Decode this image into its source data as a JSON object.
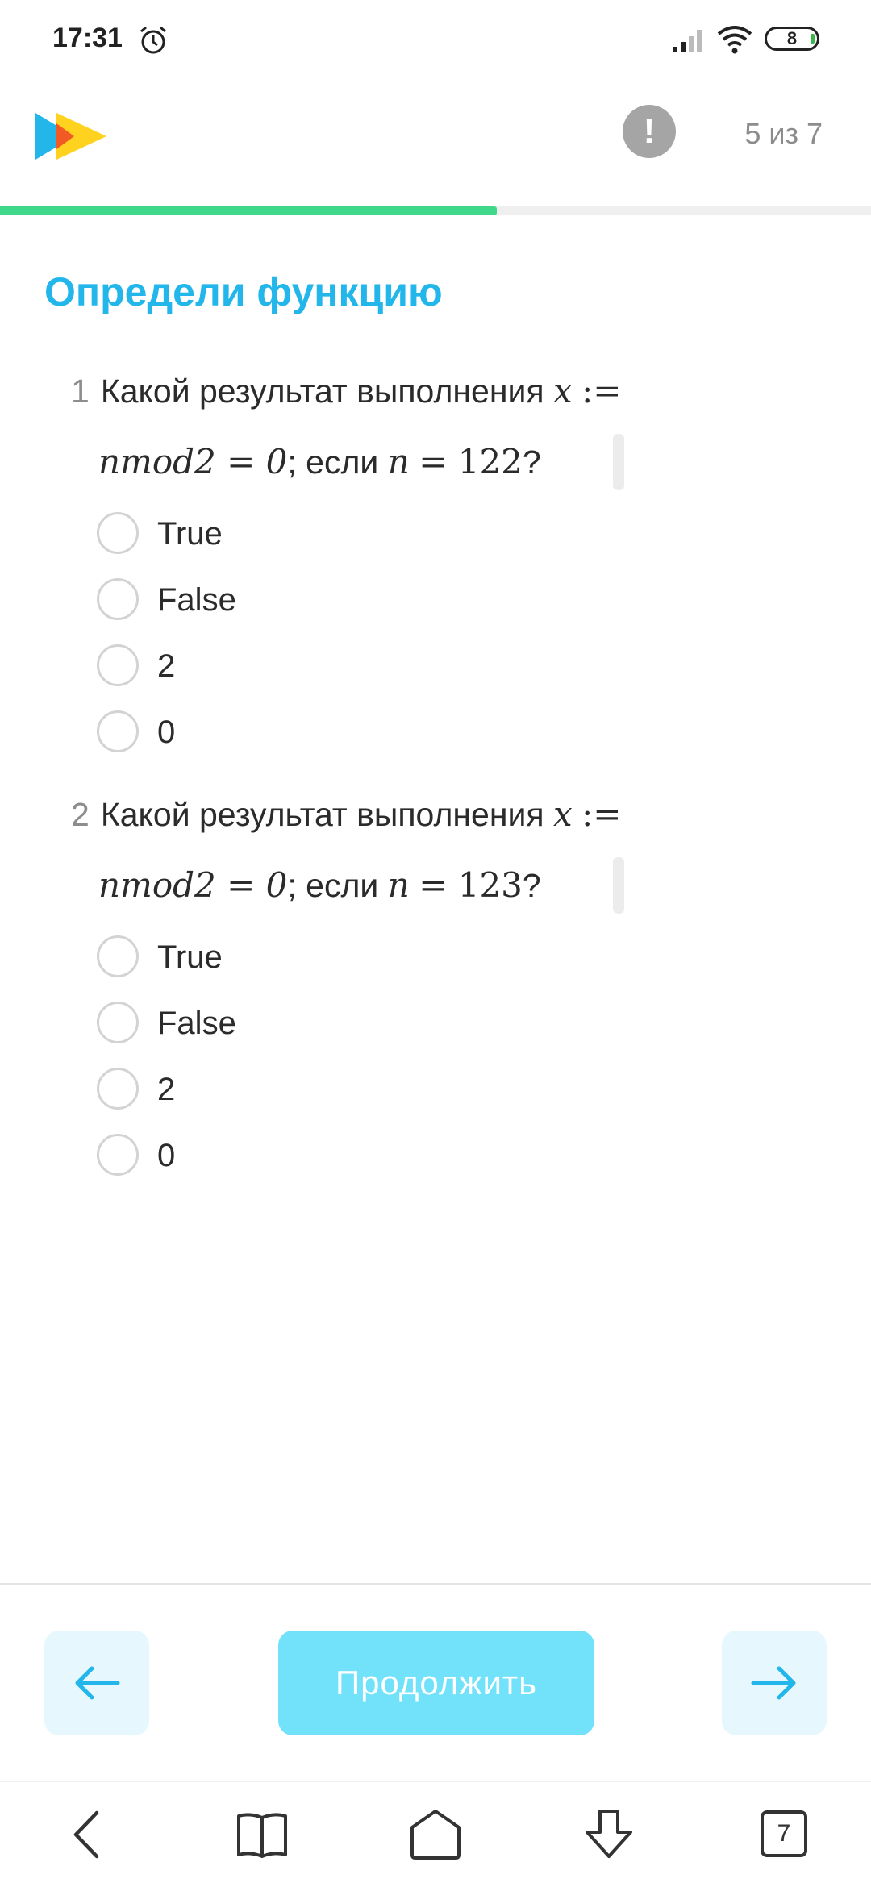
{
  "status_bar": {
    "time": "17:31",
    "battery": "8",
    "icons": [
      "alarm-icon",
      "signal-icon",
      "wifi-icon",
      "battery-icon"
    ]
  },
  "header": {
    "logo_icon": "play-logo-icon",
    "alert_symbol": "!",
    "progress_text": "5 из 7",
    "progress_fraction": 0.57
  },
  "page": {
    "title": "Определи функцию"
  },
  "questions": [
    {
      "number": "1",
      "prefix": "Какой результат выполнения",
      "math_lhs": "x",
      "math_assign": ":=",
      "math_expr": "nmod2 = 0",
      "middle": "; если",
      "math_var": "n",
      "math_value": "= 122",
      "suffix": "?",
      "options": [
        "True",
        "False",
        "2",
        "0"
      ]
    },
    {
      "number": "2",
      "prefix": "Какой результат выполнения",
      "math_lhs": "x",
      "math_assign": ":=",
      "math_expr": "nmod2 = 0",
      "middle": "; если",
      "math_var": "n",
      "math_value": "= 123",
      "suffix": "?",
      "options": [
        "True",
        "False",
        "2",
        "0"
      ]
    }
  ],
  "footer": {
    "back_icon": "arrow-left-icon",
    "forward_icon": "arrow-right-icon",
    "continue_label": "Продолжить",
    "accent_color": "#22b6ea",
    "button_color": "#72e2fb",
    "progress_color": "#3fd78a"
  },
  "system_nav": {
    "tab_count": "7",
    "icons": [
      "back-chevron-icon",
      "book-icon",
      "home-icon",
      "download-icon",
      "tabs-icon"
    ]
  }
}
